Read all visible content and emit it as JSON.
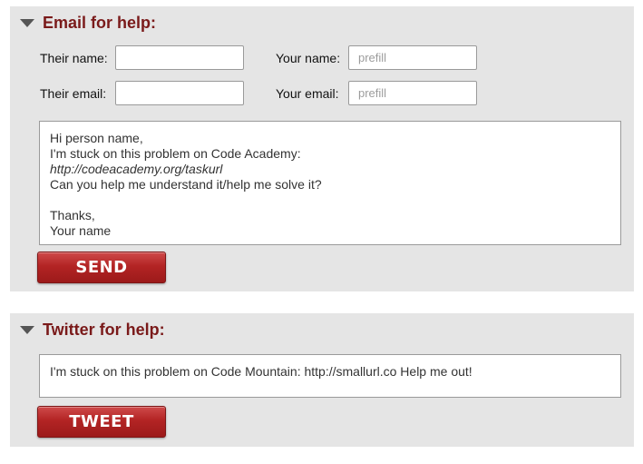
{
  "email_panel": {
    "title": "Email for help:",
    "their_name_label": "Their name:",
    "their_name_value": "",
    "their_email_label": "Their email:",
    "their_email_value": "",
    "your_name_label": "Your name:",
    "your_name_placeholder": "prefill",
    "your_email_label": "Your email:",
    "your_email_placeholder": "prefill",
    "message_lines": [
      "Hi person name,",
      "I'm stuck on this problem on Code Academy:",
      "http://codeacademy.org/taskurl",
      "Can you help me understand it/help me solve it?",
      "",
      "Thanks,",
      "Your name"
    ],
    "send_label": "SEND"
  },
  "twitter_panel": {
    "title": "Twitter for help:",
    "tweet_text": "I'm stuck on this problem on Code Mountain: http://smallurl.co Help me out!",
    "tweet_label": "TWEET"
  },
  "colors": {
    "panel_background": "#e5e5e5",
    "title_color": "#7a1a1a",
    "button_red": "#b32424"
  },
  "icons": {
    "collapse_toggle": "triangle-down-icon"
  }
}
